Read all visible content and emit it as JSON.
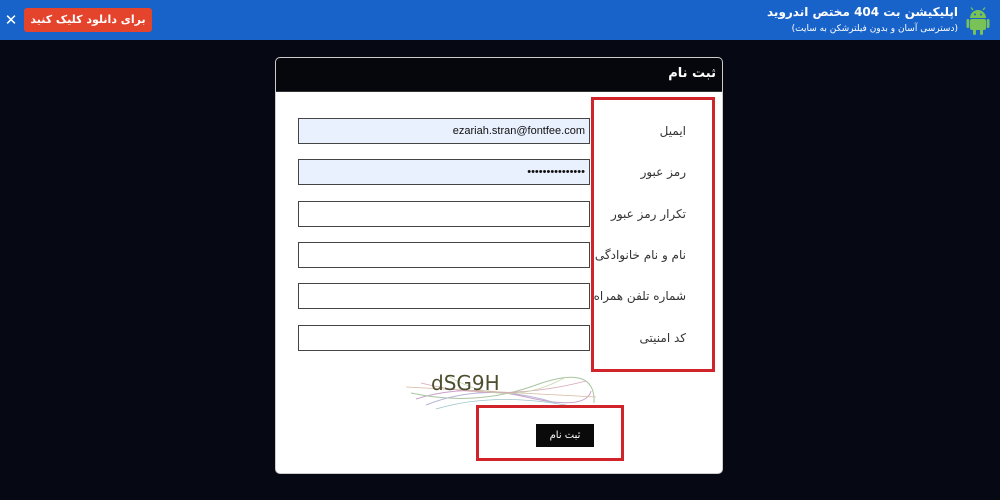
{
  "banner": {
    "close_label": "✕",
    "download_label": "برای دانلود کلیک کنید",
    "title": "اپلیکیشن بت 404 مختص اندروید",
    "subtitle": "(دسترسی آسان و بدون فیلترشکن به سایت)",
    "bg_color": "#1863c9",
    "download_color": "#e4432c",
    "android_icon": "android-icon"
  },
  "form": {
    "title": "ثبت نام",
    "fields": [
      {
        "label": "ایمیل",
        "value": "ezariah.stran@fontfee.com"
      },
      {
        "label": "رمز عبور",
        "value": "•••••••••••••••"
      },
      {
        "label": "تکرار رمز عبور",
        "value": ""
      },
      {
        "label": "نام و نام خانوادگی",
        "value": ""
      },
      {
        "label": "شماره تلفن همراه",
        "value": ""
      },
      {
        "label": "کد امنیتی",
        "value": ""
      }
    ],
    "captcha_text": "dSG9H",
    "submit_label": "ثبت نام",
    "highlight_color": "#d0232a"
  }
}
